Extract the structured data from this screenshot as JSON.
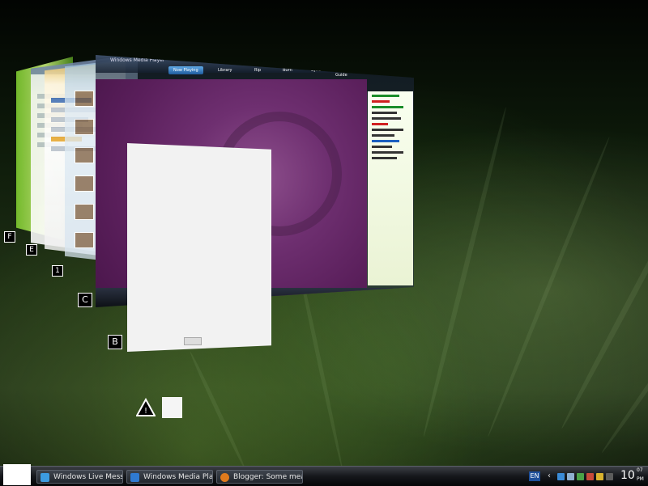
{
  "taskbar": {
    "start_label": "",
    "buttons": [
      {
        "label": "Windows Live Mess...",
        "icon": "msn-icon",
        "icon_color": "#3c9be0"
      },
      {
        "label": "Windows Media Pla...",
        "icon": "media-player-icon",
        "icon_color": "#2f7ad1"
      },
      {
        "label": "Blogger: Some mea...",
        "icon": "firefox-icon",
        "icon_color": "#e07a1c"
      }
    ],
    "tray": {
      "language": "EN",
      "overflow_arrow": "‹",
      "clock_hour": "10",
      "clock_minute": "07",
      "clock_ampm": "PM"
    }
  },
  "flip3d": {
    "windows": [
      {
        "name": "green-window"
      },
      {
        "name": "blogger-window"
      },
      {
        "name": "blogger-window-2"
      },
      {
        "name": "messenger-window"
      },
      {
        "name": "media-player-window",
        "title": "Windows Media Player",
        "tabs": [
          "Now Playing",
          "Library",
          "Rip",
          "Burn",
          "Sync",
          "Media Guide"
        ]
      },
      {
        "name": "blank-document-window"
      }
    ],
    "side_icons": [
      "F",
      "E",
      "1",
      "C",
      "B"
    ]
  },
  "colors": {
    "taskbar_bg": "#15171b",
    "wmp_viz": "#6e2f70",
    "accent_green": "#7ecb2f"
  }
}
